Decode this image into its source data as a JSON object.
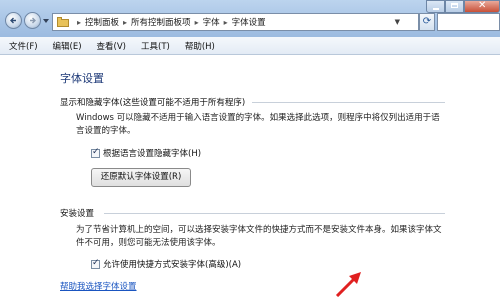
{
  "address_bar": {
    "crumbs": [
      "控制面板",
      "所有控制面板项",
      "字体",
      "字体设置"
    ]
  },
  "menu": {
    "items": [
      "文件(F)",
      "编辑(E)",
      "查看(V)",
      "工具(T)",
      "帮助(H)"
    ]
  },
  "page": {
    "title": "字体设置",
    "section1": {
      "heading": "显示和隐藏字体(这些设置可能不适用于所有程序)",
      "text": "Windows 可以隐藏不适用于输入语言设置的字体。如果选择此选项，则程序中将仅列出适用于语言设置的字体。",
      "checkbox_label": "根据语言设置隐藏字体(H)",
      "checkbox_checked": true,
      "button_label": "还原默认字体设置(R)"
    },
    "section2": {
      "heading": "安装设置",
      "text": "为了节省计算机上的空间，可以选择安装字体文件的快捷方式而不是安装文件本身。如果该字体文件不可用，则您可能无法使用该字体。",
      "checkbox_label": "允许使用快捷方式安装字体(高级)(A)",
      "checkbox_checked": true
    },
    "help_link": "帮助我选择字体设置"
  },
  "colors": {
    "title_blue": "#1e3a78",
    "link_blue": "#1a55c0",
    "arrow_red": "#e02020"
  }
}
